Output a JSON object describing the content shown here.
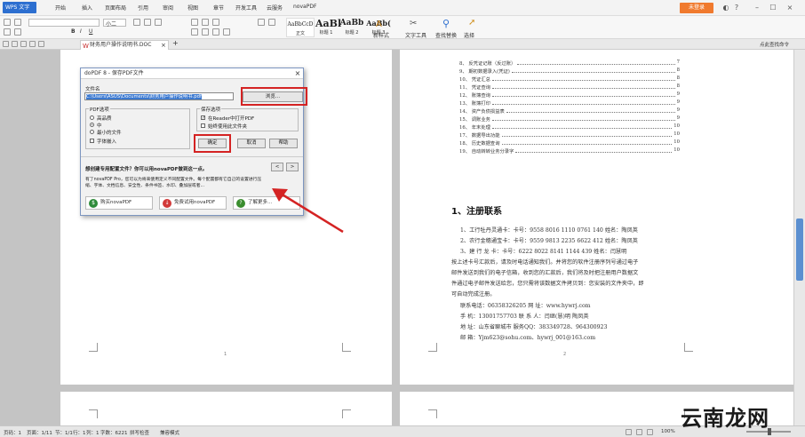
{
  "titlebar": {
    "logo": "WPS 文字",
    "menus": [
      "开始",
      "插入",
      "页面布局",
      "引用",
      "审阅",
      "视图",
      "章节",
      "开发工具",
      "云服务",
      "novaPDF"
    ],
    "login": "未登录"
  },
  "ribbon": {
    "font_size": "小二",
    "styles": [
      {
        "sample": "AaBbCcD",
        "name": "正文"
      },
      {
        "sample": "AaBl",
        "name": "标题 1"
      },
      {
        "sample": "AaBb",
        "name": "标题 2"
      },
      {
        "sample": "AaBb(",
        "name": "标题 3"
      }
    ],
    "new_style": "新样式",
    "text_tools": "文字工具",
    "find_replace": "查找替换",
    "select": "选择"
  },
  "tabs": {
    "doc_tab": "财务用户操作说明书.DOC",
    "sidebar_label": "点此查找命令"
  },
  "toc": [
    {
      "title": "8、 反凭证记账（反过账）",
      "page": "7"
    },
    {
      "title": "9、 期初数据录入(凭证)",
      "page": "8"
    },
    {
      "title": "10、 凭证汇总",
      "page": "8"
    },
    {
      "title": "11、 凭证查询",
      "page": "8"
    },
    {
      "title": "12、 账簿查询",
      "page": "9"
    },
    {
      "title": "13、 账簿打印",
      "page": "9"
    },
    {
      "title": "14、 资产负债损益表",
      "page": "9"
    },
    {
      "title": "15、 调账业务",
      "page": "9"
    },
    {
      "title": "16、 年末处理",
      "page": "10"
    },
    {
      "title": "17、 数据导出功能",
      "page": "10"
    },
    {
      "title": "18、 历史数据查询",
      "page": "10"
    },
    {
      "title": "19、 自动转转业务分录字",
      "page": "10"
    }
  ],
  "section": {
    "heading": "1、注册联系",
    "lines": [
      "1、工行牡丹灵通卡：卡号：9558 8016 1110 0761 140 姓名：陶凤英",
      "2、农行金穗通宝卡：卡号：9559 9813 2235 6622 412 姓名：陶凤英",
      "3、建    行    龙    卡：卡号：6222 8022 8141 1144 439 姓名：闫慧明",
      "     按上述卡号汇款后，请及时电话通知我们。并将您的软件注册序列号通过电子",
      "邮件发送到我们的电子信箱，收到您的汇款后，我们将及时把注册用户数据文",
      "件通过电子邮件发送给您，您只需将该数据文件拷贝到：您安装的文件夹中，即",
      "可自动完成注册。"
    ],
    "contacts": [
      "联系电话：06358326205       网    址：www.hywrj.com",
      "手      机：13001757703      联  系  人：闫继(慧)明  陶凤英",
      "地      址：山东省聊城市           服务QQ：383349728、964300923",
      "邮      箱：Yjm623@sohu.com、hywrj_001@163.com"
    ],
    "page_num_left": "1",
    "page_num_right": "2"
  },
  "dialog": {
    "title": "doPDF 8 - 保存PDF文件",
    "filename_label": "文件名",
    "filename_value": "C:\\Users\\ASUS\\Documents\\财务用户操作说明书.pdf",
    "browse": "浏览...",
    "pdf_options": "PDF选项",
    "quality_options": [
      "高品质",
      "中",
      "最小的文件"
    ],
    "embed_fonts": "字体嵌入",
    "save_options": "保存选项",
    "open_in_reader": "在Reader中打开PDF",
    "always_use_folder": "始终使用此文件夹",
    "ok": "确定",
    "cancel": "取消",
    "help": "帮助",
    "promo_title": "想创建专用配置文件？你可以用novaPDF做到这一点。",
    "promo_nav_prev": "<",
    "promo_nav_next": ">",
    "promo_line1": "有了novaPDF Pro，您可以为将来使用定义不同配置文件。每个配置都有它自己的设置进行压",
    "promo_line2": "缩、字体、文档信息、安全性、条件书签、水印、叠加层或者...",
    "buy": "购买novaPDF",
    "trial": "免费试用novaPDF",
    "learn_more": "了解更多..."
  },
  "statusbar": {
    "items": [
      "页码：1",
      "页面：1/11",
      "节：1/1",
      "行：1",
      "列：1",
      "字数：6221",
      "拼写检查",
      "兼容模式"
    ],
    "zoom": "100%"
  },
  "watermark": "云南龙网",
  "colors": {
    "accent": "#2d6fd0",
    "login": "#f07a2e",
    "highlight": "#d42323"
  }
}
